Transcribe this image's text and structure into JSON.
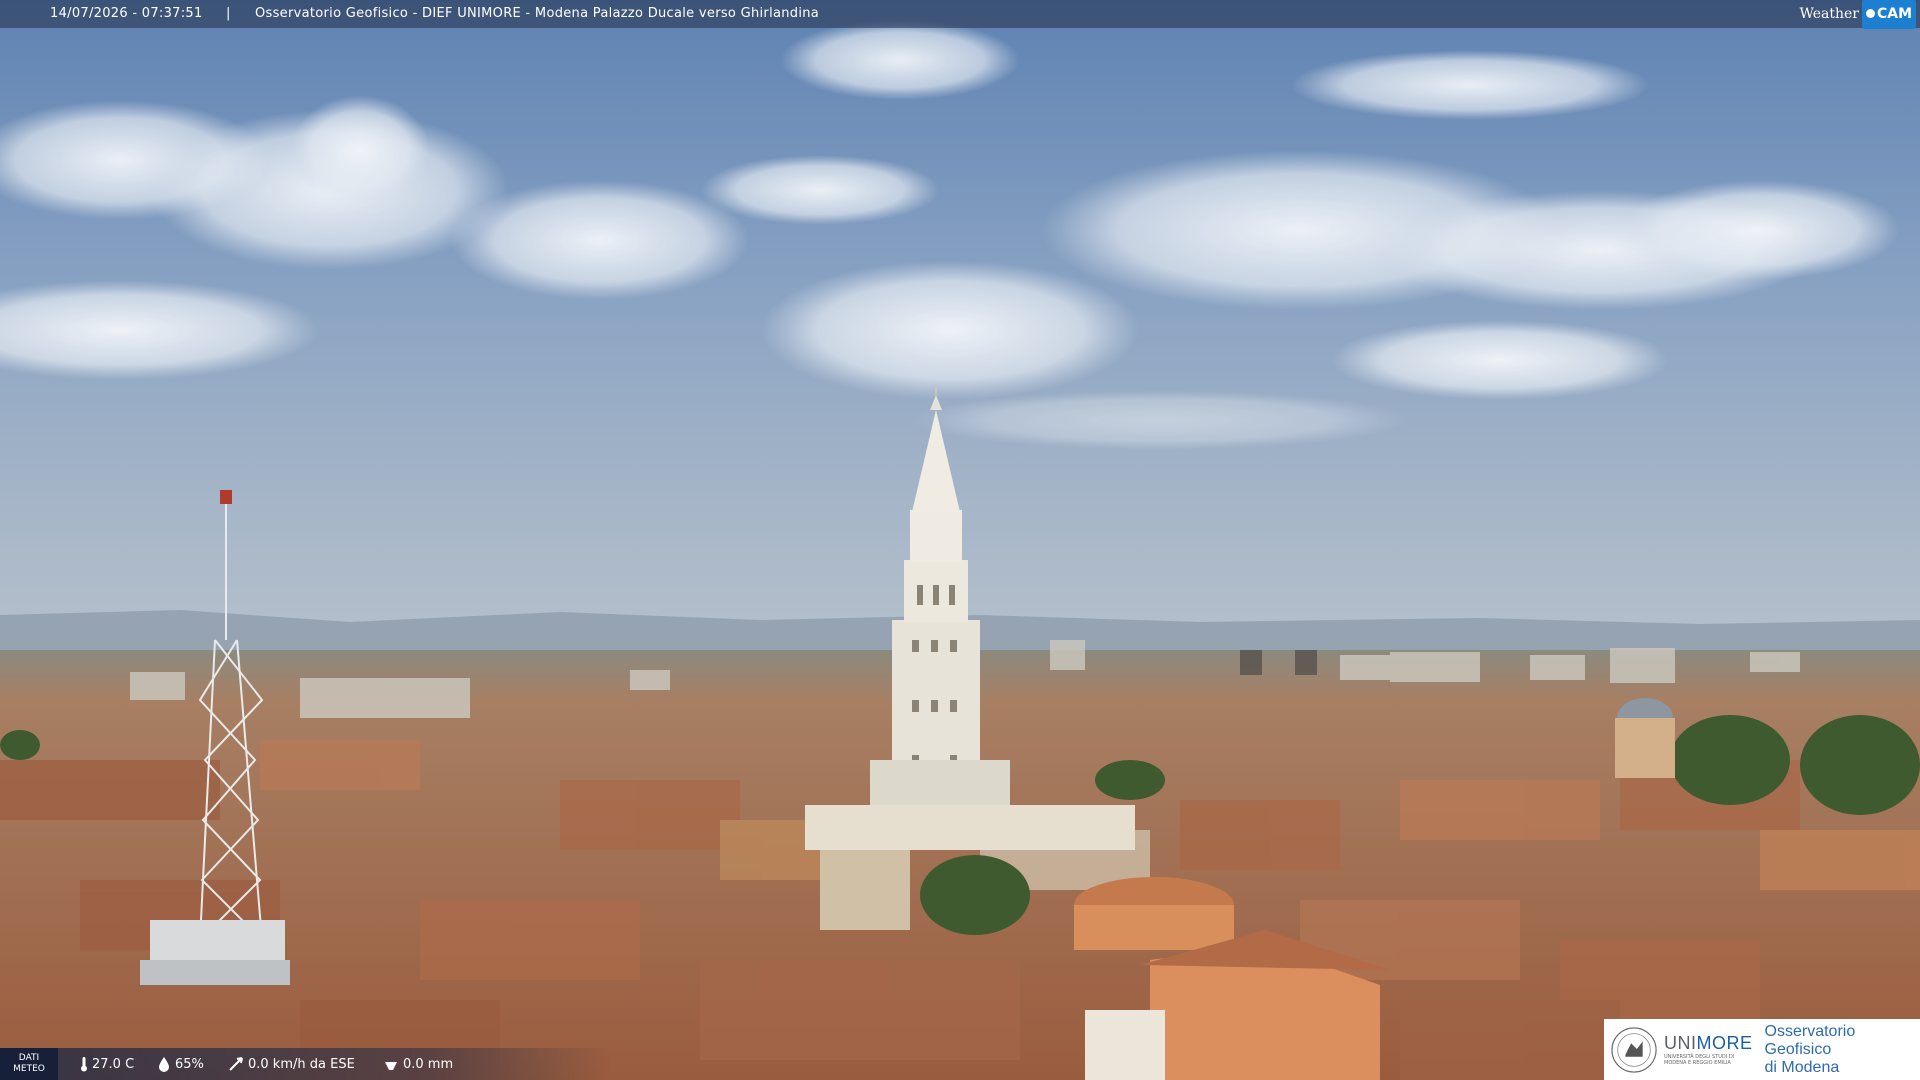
{
  "overlay": {
    "timestamp": "14/07/2026 - 07:37:51",
    "separator": "|",
    "caption": "Osservatorio Geofisico - DIEF UNIMORE - Modena Palazzo Ducale verso Ghirlandina",
    "logo": {
      "part1": "Weather",
      "part2": "CAM",
      "accent_color": "#1d7fd0"
    }
  },
  "meteo": {
    "label_line1": "DATI",
    "label_line2": "METEO",
    "temperature": "27.0 C",
    "humidity": "65%",
    "wind": "0.0 km/h da ESE",
    "rain": "0.0 mm"
  },
  "branding": {
    "university_short_pre": "UNI",
    "university_short_hl": "MORE",
    "university_full": "UNIVERSITÀ DEGLI STUDI DI MODENA E REGGIO EMILIA",
    "observatory_line1": "Osservatorio Geofisico",
    "observatory_line2": "di Modena",
    "brand_color": "#1a5ea8"
  },
  "scene": {
    "subject": "Ghirlandina tower",
    "sky_color": "#7b97bb",
    "roof_color": "#a86a4a"
  }
}
